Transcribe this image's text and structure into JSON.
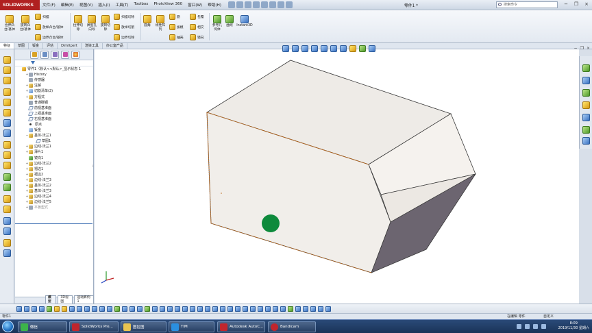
{
  "title_bar": {
    "logo_text": "SOLIDWORKS",
    "menu": [
      "文件(F)",
      "编辑(E)",
      "视图(V)",
      "插入(I)",
      "工具(T)",
      "Toolbox",
      "PhotoView 360",
      "窗口(W)",
      "帮助(H)"
    ],
    "document_title": "零件1 *",
    "search_placeholder": "搜索命令"
  },
  "command_manager": {
    "tools": [
      {
        "label": "拉伸凸\n台/基体"
      },
      {
        "label": "旋转凸\n台/基体"
      },
      {
        "label": "扫描"
      },
      {
        "label": "放样凸台/基体"
      },
      {
        "label": "边界凸台/基体"
      },
      {
        "label": "拉伸切\n除"
      },
      {
        "label": "异型孔\n向导"
      },
      {
        "label": "旋转切\n除"
      },
      {
        "label": "扫描切除"
      },
      {
        "label": "放样切割"
      },
      {
        "label": "边界切除"
      },
      {
        "label": "圆角"
      },
      {
        "label": "线性阵\n列"
      },
      {
        "label": "筋"
      },
      {
        "label": "拔模"
      },
      {
        "label": "抽壳"
      },
      {
        "label": "包覆"
      },
      {
        "label": "相交"
      },
      {
        "label": "镜向"
      },
      {
        "label": "参考几\n何体"
      },
      {
        "label": "曲线"
      },
      {
        "label": "Instant3D"
      }
    ]
  },
  "tabs": [
    "特征",
    "草图",
    "钣金",
    "评估",
    "DimXpert",
    "渲染工具",
    "办公室产品"
  ],
  "feature_tree": {
    "root": "零件1（默认<<默认>_显示状态 1",
    "items": [
      {
        "label": "History",
        "icon": "history-icon",
        "level": 1
      },
      {
        "label": "传感器",
        "icon": "sensor-icon",
        "level": 1
      },
      {
        "label": "注解",
        "icon": "annotation-icon",
        "level": 1
      },
      {
        "label": "切割清单(2)",
        "icon": "cutlist-icon",
        "level": 1
      },
      {
        "label": "方程式",
        "icon": "equation-icon",
        "level": 1
      },
      {
        "label": "普通碳钢",
        "icon": "material-icon",
        "level": 1
      },
      {
        "label": "前视基准面",
        "icon": "plane-icon",
        "level": 1
      },
      {
        "label": "上视基准面",
        "icon": "plane-icon",
        "level": 1
      },
      {
        "label": "右视基准面",
        "icon": "plane-icon",
        "level": 1
      },
      {
        "label": "原点",
        "icon": "origin-icon",
        "level": 1
      },
      {
        "label": "钣金",
        "icon": "sheetmetal-icon",
        "level": 1
      },
      {
        "label": "基体-法兰1",
        "icon": "base-flange-icon",
        "level": 1
      },
      {
        "label": "草图1",
        "icon": "sketch-icon",
        "level": 2
      },
      {
        "label": "边线-法兰1",
        "icon": "edge-flange-icon",
        "level": 1
      },
      {
        "label": "薄片1",
        "icon": "tab-feature-icon",
        "level": 1
      },
      {
        "label": "镜向1",
        "icon": "mirror-icon",
        "level": 1
      },
      {
        "label": "边线-法兰2",
        "icon": "edge-flange-icon",
        "level": 1
      },
      {
        "label": "褶边1",
        "icon": "hem-icon",
        "level": 1
      },
      {
        "label": "褶边2",
        "icon": "hem-icon",
        "level": 1
      },
      {
        "label": "边线-法兰3",
        "icon": "edge-flange-icon",
        "level": 1
      },
      {
        "label": "基体-法兰2",
        "icon": "base-flange-icon",
        "level": 1
      },
      {
        "label": "基体-法兰3",
        "icon": "base-flange-icon",
        "level": 1
      },
      {
        "label": "边线-法兰4",
        "icon": "edge-flange-icon",
        "level": 1
      },
      {
        "label": "边线-法兰5",
        "icon": "edge-flange-icon",
        "level": 1
      },
      {
        "label": "平板型式",
        "icon": "flat-pattern-icon",
        "level": 1
      }
    ]
  },
  "model_tabs": [
    "模型",
    "3D视图",
    "运动算例 1"
  ],
  "status_bar": {
    "left": "零件1",
    "middle": "在编辑 零件",
    "units": "自定义"
  },
  "taskbar": {
    "items": [
      {
        "label": "微信",
        "color": "#3cb34a"
      },
      {
        "label": "SolidWorks Pre...",
        "color": "#c0262d"
      },
      {
        "label": "图拉图",
        "color": "#e8c450"
      },
      {
        "label": "TIM",
        "color": "#2a8fe0"
      },
      {
        "label": "Autodesk AutoC...",
        "color": "#c0262d"
      },
      {
        "label": "Bandicam",
        "color": "#c0262d"
      }
    ],
    "clock_time": "8:09",
    "clock_date": "2019/11/30 星期六"
  },
  "colors": {
    "box_light_face": "#eeebe7",
    "box_dark_face": "#6c6570",
    "box_edge": "#b86418",
    "green_dot": "#0e8a3c",
    "logo": "#b02020"
  }
}
